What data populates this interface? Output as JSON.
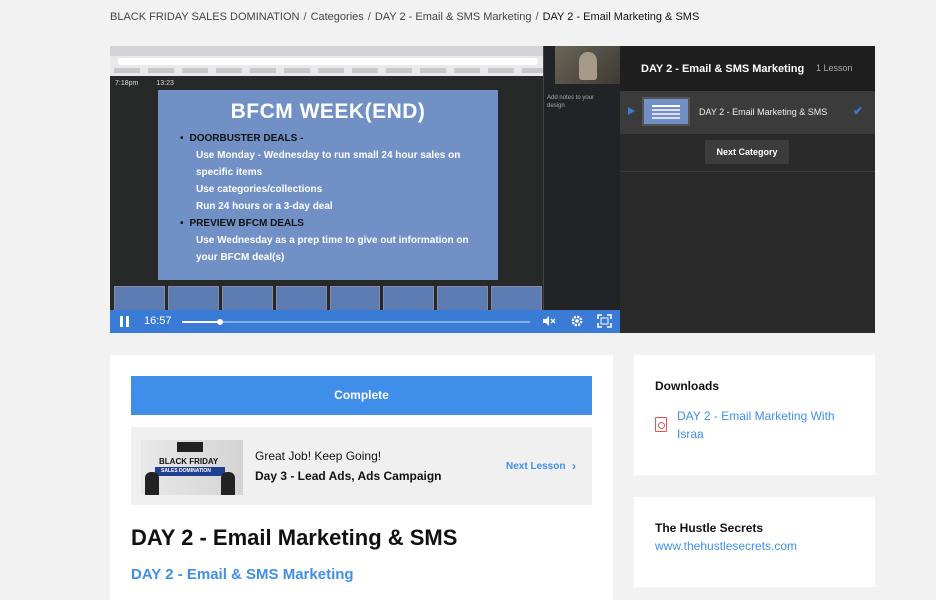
{
  "breadcrumb": {
    "items": [
      "BLACK FRIDAY SALES DOMINATION",
      "Categories",
      "DAY 2 - Email & SMS Marketing"
    ],
    "separator": "/",
    "current": "DAY 2 - Email Marketing & SMS"
  },
  "video": {
    "screen_clock": "7:18pm",
    "screen_counter": "13:23",
    "slide": {
      "title": "BFCM WEEK(END)",
      "bullets": [
        {
          "text": "DOORBUSTER DEALS -",
          "level": "main"
        },
        {
          "text": "Use Monday - Wednesday to run small 24 hour sales on",
          "level": "sub"
        },
        {
          "text": "specific items",
          "level": "sub"
        },
        {
          "text": "Use categories/collections",
          "level": "sub"
        },
        {
          "text": "Run 24 hours or a 3-day deal",
          "level": "sub"
        },
        {
          "text": "PREVIEW BFCM DEALS",
          "level": "main"
        },
        {
          "text": "Use Wednesday as a prep time to give out information on",
          "level": "sub"
        },
        {
          "text": "your BFCM deal(s)",
          "level": "sub"
        }
      ]
    },
    "notes_placeholder": "Add notes to your design",
    "time_display": "16:57",
    "progress_fraction": 0.11
  },
  "lesson_panel": {
    "title": "DAY 2 - Email & SMS Marketing",
    "count": "1 Lesson",
    "items": [
      {
        "label": "DAY 2 - Email Marketing & SMS",
        "completed": true
      }
    ],
    "next_category_label": "Next Category"
  },
  "main": {
    "complete_label": "Complete",
    "next": {
      "thumb_title": "BLACK FRIDAY",
      "thumb_subtitle": "SALES DOMINATION",
      "encouragement": "Great Job! Keep Going!",
      "lesson_name": "Day 3 - Lead Ads, Ads Campaign",
      "link_label": "Next Lesson"
    },
    "lesson_title": "DAY 2 - Email Marketing & SMS",
    "lesson_subtitle": "DAY 2 - Email & SMS Marketing"
  },
  "downloads": {
    "heading": "Downloads",
    "files": [
      {
        "name": "DAY 2 - Email Marketing With Israa",
        "icon": "pdf-file-icon"
      }
    ]
  },
  "sidebar_box": {
    "heading": "The Hustle Secrets",
    "link": "www.thehustlesecrets.com"
  },
  "colors": {
    "accent": "#3f8fea",
    "video_controls": "#3a7bd5",
    "panel_dark": "#2a2a2a",
    "slide_blue": "#7191c6"
  }
}
